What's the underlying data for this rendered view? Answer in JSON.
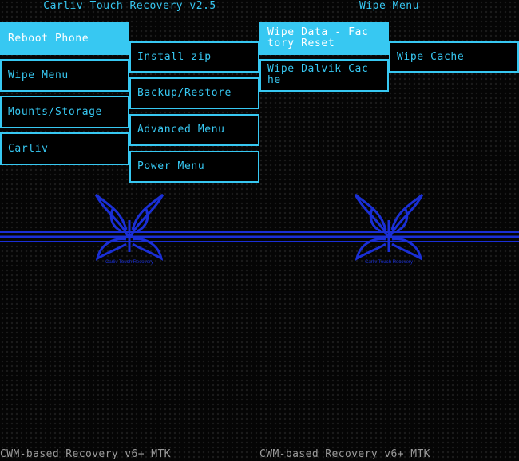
{
  "left": {
    "title": "Carliv Touch Recovery v2.5",
    "column1": [
      {
        "label": "Reboot Phone",
        "selected": true
      },
      {
        "label": "Wipe Menu"
      },
      {
        "label": "Mounts/Storage"
      },
      {
        "label": "Carliv"
      }
    ],
    "column2": [
      {
        "label": "Install zip"
      },
      {
        "label": "Backup/Restore"
      },
      {
        "label": "Advanced Menu"
      },
      {
        "label": "Power Menu"
      }
    ],
    "footer": "CWM-based Recovery v6+ MTK"
  },
  "right": {
    "title": "Wipe Menu",
    "column1": [
      {
        "label": "Wipe Data - Fac\ntory Reset",
        "selected": true
      },
      {
        "label": "Wipe Dalvik Cac\nhe"
      }
    ],
    "column2": [
      {
        "label": "Wipe Cache"
      }
    ],
    "footer": "CWM-based Recovery v6+ MTK"
  },
  "colors": {
    "accent": "#37c8f2",
    "selected_text": "#ffffff",
    "logo_blue": "#1a2fd6",
    "background": "#050505",
    "footer_text": "#9a9a9a"
  },
  "logo": {
    "icon": "butterfly-logo-icon",
    "caption": "Carliv Touch Recovery"
  }
}
